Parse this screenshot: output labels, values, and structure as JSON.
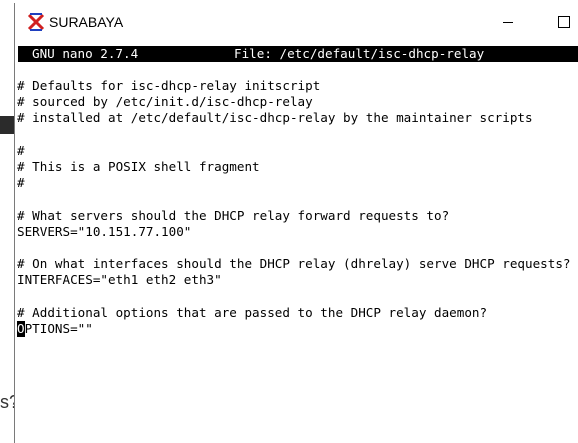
{
  "window": {
    "title": "SURABAYA",
    "minimize_glyph": "—",
    "maximize_glyph": "☐"
  },
  "background": {
    "partial_text": "s?"
  },
  "nano": {
    "version": "GNU nano 2.7.4",
    "file_label": "File: /etc/default/isc-dhcp-relay"
  },
  "editor": {
    "lines": [
      "# Defaults for isc-dhcp-relay initscript",
      "# sourced by /etc/init.d/isc-dhcp-relay",
      "# installed at /etc/default/isc-dhcp-relay by the maintainer scripts",
      "",
      "#",
      "# This is a POSIX shell fragment",
      "#",
      "",
      "# What servers should the DHCP relay forward requests to?",
      "SERVERS=\"10.151.77.100\"",
      "",
      "# On what interfaces should the DHCP relay (dhrelay) serve DHCP requests?",
      "INTERFACES=\"eth1 eth2 eth3\"",
      "",
      "# Additional options that are passed to the DHCP relay daemon?"
    ],
    "cursor_char": "O",
    "cursor_line_rest": "PTIONS=\"\""
  },
  "colors": {
    "header_bg": "#000000",
    "header_fg": "#ffffff",
    "text": "#000000",
    "icon_blue": "#1f3fbf",
    "icon_red": "#d02020"
  }
}
